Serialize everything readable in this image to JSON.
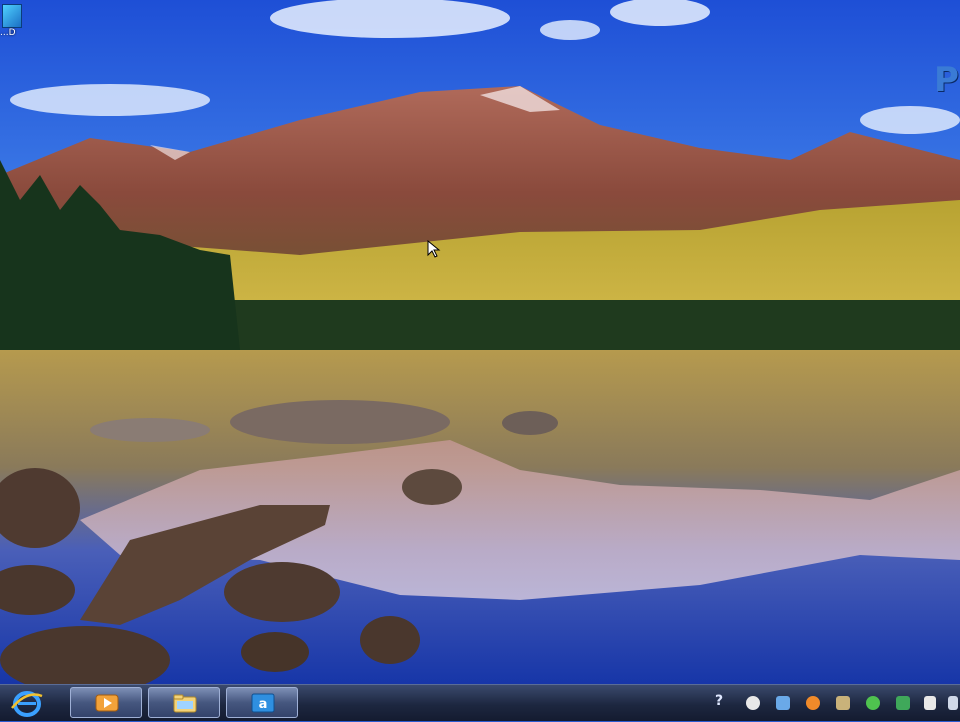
{
  "desktop": {
    "icon": {
      "name": "desktop-shortcut-icon",
      "label": "...D"
    },
    "edge_logo_text": "P"
  },
  "taskbar": {
    "start": {
      "icon": "internet-explorer-icon"
    },
    "pinned": [
      {
        "name": "media-player-button",
        "icon": "media-player-icon"
      },
      {
        "name": "explorer-button",
        "icon": "folder-icon"
      },
      {
        "name": "app-button",
        "icon": "app-icon"
      }
    ],
    "help_text": "?",
    "tray_icons": [
      "chat-icon",
      "network-icon",
      "firefox-icon",
      "folder-icon",
      "messenger-icon",
      "security-icon",
      "flag-icon",
      "volume-icon"
    ]
  },
  "colors": {
    "sky": "#2a5bd0",
    "taskbar": "#1d2740",
    "lake": "#1b3ea8"
  }
}
